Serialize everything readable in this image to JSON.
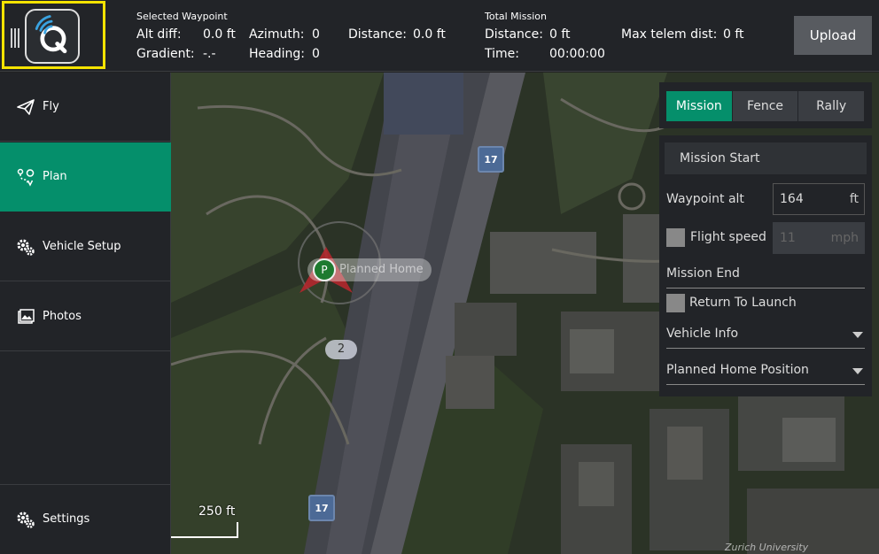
{
  "topbar": {
    "selected_waypoint": {
      "heading": "Selected Waypoint",
      "alt_diff_label": "Alt diff:",
      "alt_diff_value": "0.0 ft",
      "gradient_label": "Gradient:",
      "gradient_value": "-.-",
      "azimuth_label": "Azimuth:",
      "azimuth_value": "0",
      "heading_label": "Heading:",
      "heading_value": "0",
      "distance_label": "Distance:",
      "distance_value": "0.0 ft"
    },
    "total_mission": {
      "heading": "Total Mission",
      "distance_label": "Distance:",
      "distance_value": "0 ft",
      "time_label": "Time:",
      "time_value": "00:00:00",
      "max_telem_label": "Max telem dist:",
      "max_telem_value": "0 ft"
    },
    "upload_label": "Upload"
  },
  "nav": {
    "fly": "Fly",
    "plan": "Plan",
    "vehicle_setup": "Vehicle Setup",
    "photos": "Photos",
    "settings": "Settings"
  },
  "map": {
    "road_badge_1": "17",
    "road_badge_2": "17",
    "home_marker_letter": "P",
    "home_label": "Planned Home",
    "waypoint_number": "2",
    "scale_label": "250 ft",
    "credit": "Zurich University"
  },
  "tabs": [
    "Mission",
    "Fence",
    "Rally"
  ],
  "panel": {
    "mission_start": "Mission Start",
    "waypoint_alt_label": "Waypoint alt",
    "waypoint_alt_value": "164",
    "waypoint_alt_unit": "ft",
    "flight_speed_label": "Flight speed",
    "flight_speed_value": "11",
    "flight_speed_unit": "mph",
    "mission_end": "Mission End",
    "return_to_launch": "Return To Launch",
    "vehicle_info": "Vehicle Info",
    "planned_home_position": "Planned Home Position"
  },
  "colors": {
    "accent": "#058f6b",
    "highlight_border": "#f5e300",
    "panel_bg": "#222428"
  }
}
